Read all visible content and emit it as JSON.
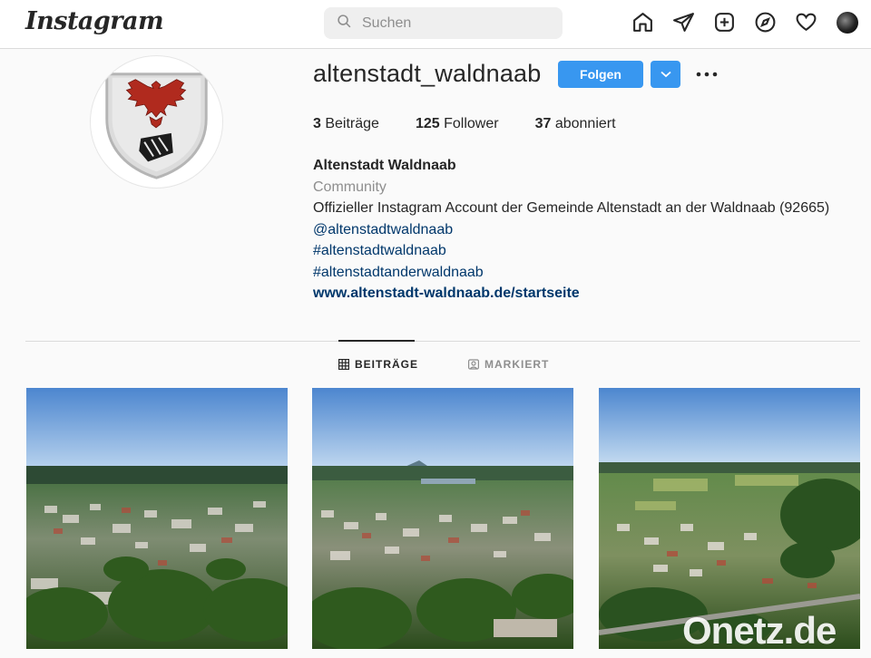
{
  "header": {
    "logo": "Instagram",
    "search_placeholder": "Suchen"
  },
  "profile": {
    "username": "altenstadt_waldnaab",
    "follow_label": "Folgen",
    "stats": [
      {
        "count": "3",
        "label": "Beiträge"
      },
      {
        "count": "125",
        "label": "Follower"
      },
      {
        "count": "37",
        "label": "abonniert"
      }
    ],
    "full_name": "Altenstadt Waldnaab",
    "category": "Community",
    "bio": "Offizieller Instagram Account der Gemeinde Altenstadt an der Waldnaab (92665)",
    "mention": "@altenstadtwaldnaab",
    "hashtag1": "#altenstadtwaldnaab",
    "hashtag2": "#altenstadtanderwaldnaab",
    "website": "www.altenstadt-waldnaab.de/startseite"
  },
  "tabs": {
    "posts": "BEITRÄGE",
    "tagged": "MARKIERT"
  },
  "watermark": "Onetz.de",
  "colors": {
    "accent": "#3897f0",
    "link": "#00376b",
    "sky": "#7fb0e0",
    "foliage": "#2f5a1e"
  },
  "icons": [
    "search-icon",
    "home-icon",
    "direct-icon",
    "new-post-icon",
    "explore-icon",
    "heart-icon",
    "chevron-down-icon",
    "more-icon",
    "grid-icon",
    "tagged-icon"
  ]
}
